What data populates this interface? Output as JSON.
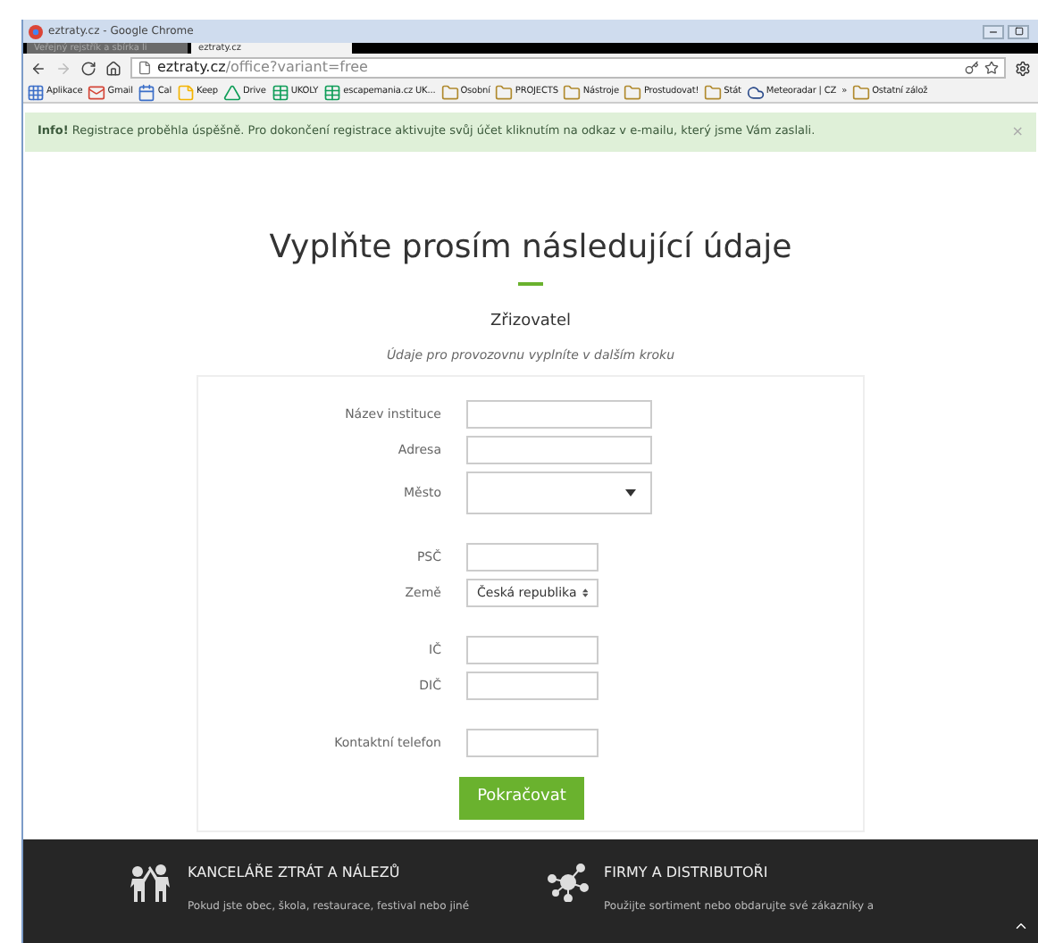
{
  "window": {
    "title": "eztraty.cz - Google Chrome"
  },
  "tabs": [
    {
      "label": "Veřejný rejstřík a sbírka li",
      "selected": false
    },
    {
      "label": "eztraty.cz",
      "selected": true
    }
  ],
  "address_bar": {
    "host": "eztraty.cz",
    "path": "/office?variant=free"
  },
  "bookmarks": [
    {
      "kind": "apps",
      "label": "Aplikace"
    },
    {
      "kind": "mail",
      "label": "Gmail"
    },
    {
      "kind": "calendar",
      "label": "Cal"
    },
    {
      "kind": "note",
      "label": "Keep"
    },
    {
      "kind": "drive",
      "label": "Drive"
    },
    {
      "kind": "sheet",
      "label": "UKOLY"
    },
    {
      "kind": "sheet",
      "label": "escapemania.cz UK..."
    },
    {
      "kind": "folder",
      "label": "Osobní"
    },
    {
      "kind": "folder",
      "label": "PROJECTS"
    },
    {
      "kind": "folder",
      "label": "Nástroje"
    },
    {
      "kind": "folder",
      "label": "Prostudovat!"
    },
    {
      "kind": "folder",
      "label": "Stát"
    },
    {
      "kind": "weather",
      "label": "Meteoradar | CZ"
    },
    {
      "kind": "more",
      "label": "»"
    },
    {
      "kind": "folder",
      "label": "Ostatní zálož"
    }
  ],
  "alert": {
    "text": "**Info!** Registrace proběhla úspěšně. Pro dokončení registrace aktivujte svůj účet kliknutím na odkaz v e-mailu, který jsme Vám zaslali.",
    "close": "×"
  },
  "heading": "Vyplňte prosím následující údaje",
  "section": {
    "title": "Zřizovatel",
    "subtitle": "Údaje pro provozovnu vyplníte v dalším kroku"
  },
  "fields": [
    {
      "kind": "wide",
      "label": "Název instituce"
    },
    {
      "kind": "wide",
      "label": "Adresa"
    },
    {
      "kind": "combo",
      "label": "Město"
    },
    {
      "kind": "gap"
    },
    {
      "kind": "text",
      "label": "PSČ"
    },
    {
      "kind": "select",
      "label": "Země",
      "value": "Česká republika"
    },
    {
      "kind": "gap"
    },
    {
      "kind": "text",
      "label": "IČ"
    },
    {
      "kind": "text",
      "label": "DIČ"
    },
    {
      "kind": "gap"
    },
    {
      "kind": "text",
      "label": "Kontaktní telefon"
    }
  ],
  "submit": "Pokračovat",
  "footer": [
    {
      "kind": "people",
      "title": "KANCELÁŘE ZTRÁT A NÁLEZŮ",
      "text": "Pokud jste obec, škola, restaurace, festival nebo jiné"
    },
    {
      "kind": "network",
      "title": "FIRMY A DISTRIBUTOŘI",
      "text": "Použijte sortiment nebo obdarujte své zákazníky a"
    }
  ]
}
